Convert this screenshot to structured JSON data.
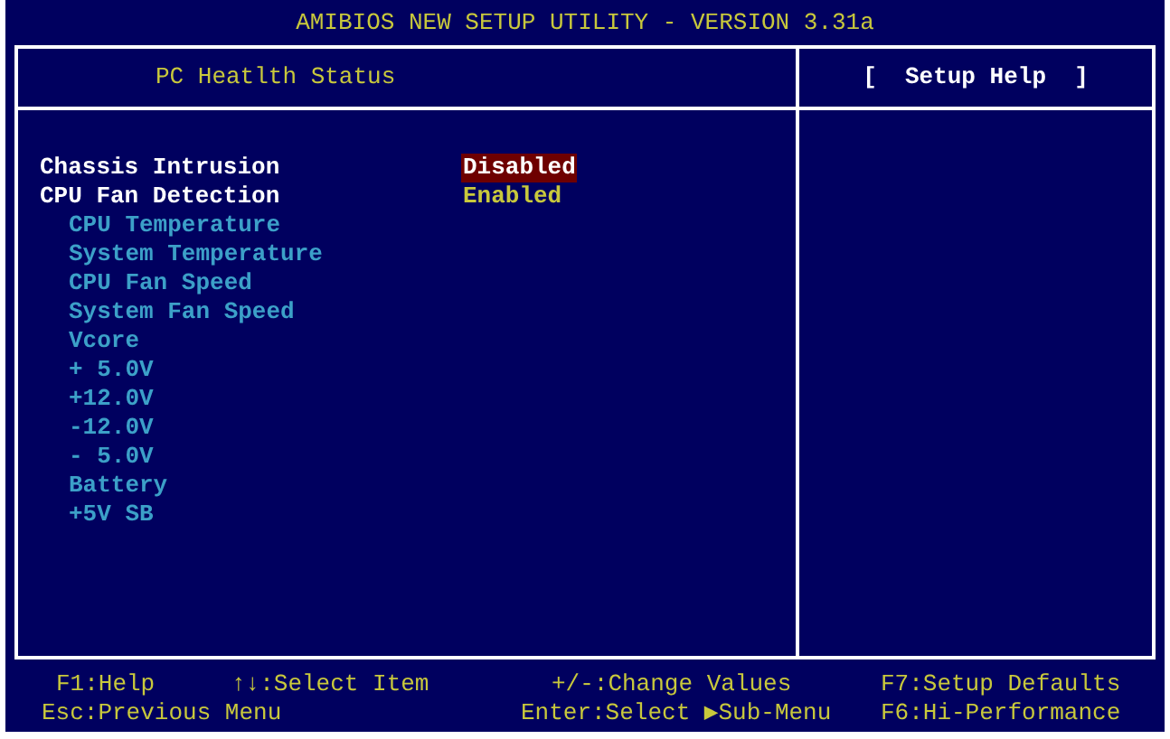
{
  "title": "AMIBIOS NEW SETUP UTILITY - VERSION 3.31a",
  "panel_title": "PC Heatlth Status",
  "help_title": "[  Setup Help  ]",
  "items": [
    {
      "kind": "setting",
      "label": "Chassis Intrusion",
      "value": "Disabled",
      "selected": true
    },
    {
      "kind": "setting",
      "label": "CPU Fan Detection",
      "value": "Enabled",
      "selected": false
    },
    {
      "kind": "reading",
      "label": "CPU Temperature"
    },
    {
      "kind": "reading",
      "label": "System Temperature"
    },
    {
      "kind": "reading",
      "label": "CPU Fan Speed"
    },
    {
      "kind": "reading",
      "label": "System Fan Speed"
    },
    {
      "kind": "reading",
      "label": "Vcore"
    },
    {
      "kind": "reading",
      "label": "+ 5.0V"
    },
    {
      "kind": "reading",
      "label": "+12.0V"
    },
    {
      "kind": "reading",
      "label": "-12.0V"
    },
    {
      "kind": "reading",
      "label": "- 5.0V"
    },
    {
      "kind": "reading",
      "label": "Battery"
    },
    {
      "kind": "reading",
      "label": "+5V SB"
    }
  ],
  "footer": [
    [
      "F1:Help",
      "↑↓:Select Item",
      "+/-:Change Values",
      "F7:Setup Defaults"
    ],
    [
      "Esc:Previous Menu",
      "Enter:Select ▶Sub-Menu",
      "F6:Hi-Performance"
    ]
  ]
}
